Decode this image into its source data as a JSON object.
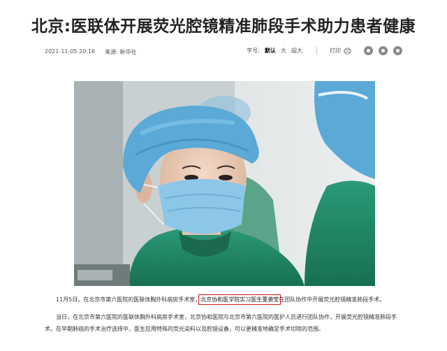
{
  "article": {
    "title": "北京:医联体开展荧光腔镜精准肺段手术助力患者健康",
    "meta": {
      "datetime": "2021-11-05 20:16",
      "source_label": "来源:",
      "source": "新华社",
      "font_size_label": "字号:",
      "font_sizes": [
        "默认",
        "大",
        "超大"
      ],
      "print_label": "打印"
    },
    "share_icons": [
      "share-icon",
      "weibo-icon",
      "qzone-icon"
    ],
    "paragraph1": {
      "before": "11月5日，在北京市第六医院的医联体胸外科病房手术室，",
      "highlight": "北京协和医学院实习医生董袭莹",
      "after": "在团队协作中开展荧光腔镜精准肺段手术。"
    },
    "paragraph2": "当日，在北京市第六医院的医联体胸外科病房手术室，北京协和医院与北京市第六医院的医护人员进行团队协作，开展荧光腔镜精准肺段手术。在早期肺癌的手术治疗选择中，医生应用特殊的荧光染料以及腔镜设备，可以更精准地确定手术切除的范围。"
  },
  "colors": {
    "highlight_border": "#d01c1c",
    "scrub": "#1f8a6a",
    "cap": "#5aa9d6"
  }
}
